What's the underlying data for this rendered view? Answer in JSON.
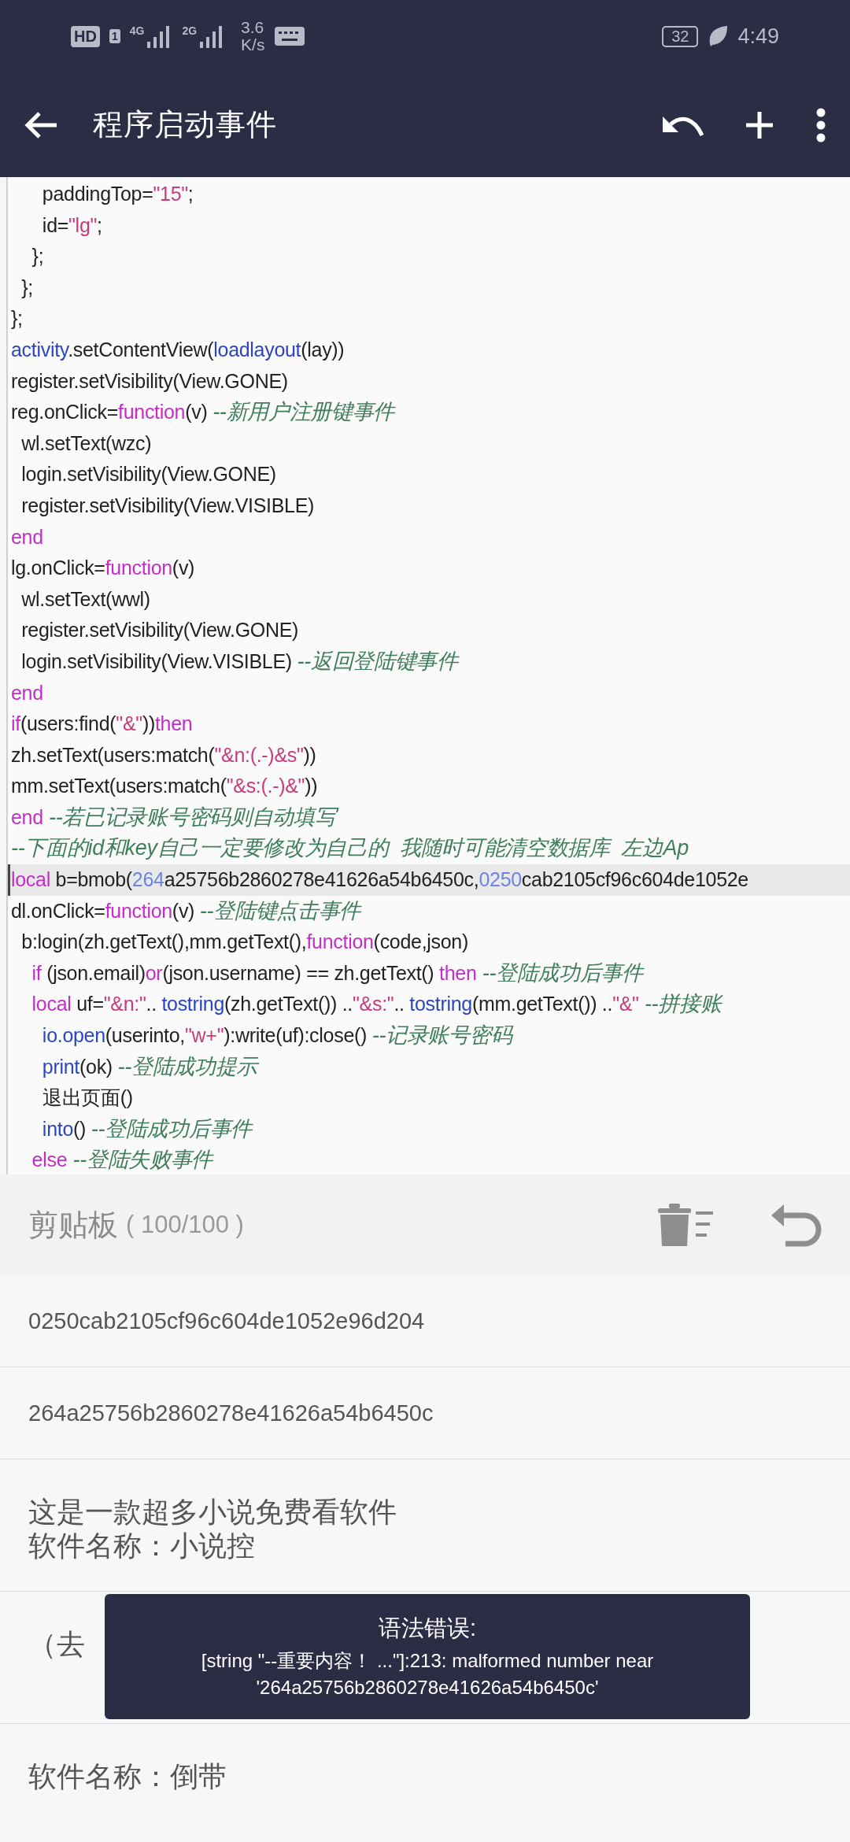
{
  "status_bar": {
    "hd": "HD",
    "sim": "1",
    "signals": [
      "4G",
      "2G"
    ],
    "speed_value": "3.6",
    "speed_unit": "K/s",
    "battery": "32",
    "time": "4:49"
  },
  "toolbar": {
    "title": "程序启动事件"
  },
  "editor": {
    "lines": [
      {
        "current": false,
        "tokens": [
          {
            "kind": "plain",
            "text": "      paddingTop="
          },
          {
            "kind": "str",
            "text": "\"15\""
          },
          {
            "kind": "plain",
            "text": ";"
          }
        ]
      },
      {
        "current": false,
        "tokens": [
          {
            "kind": "plain",
            "text": "      id="
          },
          {
            "kind": "str",
            "text": "\"lg\""
          },
          {
            "kind": "plain",
            "text": ";"
          }
        ]
      },
      {
        "current": false,
        "tokens": [
          {
            "kind": "plain",
            "text": "    };"
          }
        ]
      },
      {
        "current": false,
        "tokens": [
          {
            "kind": "plain",
            "text": "  };"
          }
        ]
      },
      {
        "current": false,
        "tokens": [
          {
            "kind": "plain",
            "text": "};"
          }
        ]
      },
      {
        "current": false,
        "tokens": [
          {
            "kind": "fn",
            "text": "activity"
          },
          {
            "kind": "plain",
            "text": ".setContentView("
          },
          {
            "kind": "fn",
            "text": "loadlayout"
          },
          {
            "kind": "plain",
            "text": "(lay))"
          }
        ]
      },
      {
        "current": false,
        "tokens": [
          {
            "kind": "plain",
            "text": "register.setVisibility(View.GONE)"
          }
        ]
      },
      {
        "current": false,
        "tokens": [
          {
            "kind": "plain",
            "text": "reg.onClick="
          },
          {
            "kind": "kw",
            "text": "function"
          },
          {
            "kind": "plain",
            "text": "(v) "
          },
          {
            "kind": "cmt",
            "text": "--新用户注册键事件"
          }
        ]
      },
      {
        "current": false,
        "tokens": [
          {
            "kind": "plain",
            "text": "  wl.setText(wzc)"
          }
        ]
      },
      {
        "current": false,
        "tokens": [
          {
            "kind": "plain",
            "text": "  login.setVisibility(View.GONE)"
          }
        ]
      },
      {
        "current": false,
        "tokens": [
          {
            "kind": "plain",
            "text": "  register.setVisibility(View.VISIBLE)"
          }
        ]
      },
      {
        "current": false,
        "tokens": [
          {
            "kind": "kw",
            "text": "end"
          }
        ]
      },
      {
        "current": false,
        "tokens": [
          {
            "kind": "plain",
            "text": "lg.onClick="
          },
          {
            "kind": "kw",
            "text": "function"
          },
          {
            "kind": "plain",
            "text": "(v)"
          }
        ]
      },
      {
        "current": false,
        "tokens": [
          {
            "kind": "plain",
            "text": "  wl.setText(wwl)"
          }
        ]
      },
      {
        "current": false,
        "tokens": [
          {
            "kind": "plain",
            "text": "  register.setVisibility(View.GONE)"
          }
        ]
      },
      {
        "current": false,
        "tokens": [
          {
            "kind": "plain",
            "text": "  login.setVisibility(View.VISIBLE) "
          },
          {
            "kind": "cmt",
            "text": "--返回登陆键事件"
          }
        ]
      },
      {
        "current": false,
        "tokens": [
          {
            "kind": "kw",
            "text": "end"
          }
        ]
      },
      {
        "current": false,
        "tokens": [
          {
            "kind": "kw",
            "text": "if"
          },
          {
            "kind": "plain",
            "text": "(users:find("
          },
          {
            "kind": "str",
            "text": "\"&\""
          },
          {
            "kind": "plain",
            "text": "))"
          },
          {
            "kind": "kw",
            "text": "then"
          }
        ]
      },
      {
        "current": false,
        "tokens": [
          {
            "kind": "plain",
            "text": "zh.setText(users:match("
          },
          {
            "kind": "str",
            "text": "\"&n:(.-)&s\""
          },
          {
            "kind": "plain",
            "text": "))"
          }
        ]
      },
      {
        "current": false,
        "tokens": [
          {
            "kind": "plain",
            "text": "mm.setText(users:match("
          },
          {
            "kind": "str",
            "text": "\"&s:(.-)&\""
          },
          {
            "kind": "plain",
            "text": "))"
          }
        ]
      },
      {
        "current": false,
        "tokens": [
          {
            "kind": "kw",
            "text": "end"
          },
          {
            "kind": "cmt",
            "text": " --若已记录账号密码则自动填写"
          }
        ]
      },
      {
        "current": false,
        "tokens": [
          {
            "kind": "cmt",
            "text": "--下面的id和key自己一定要修改为自己的  我随时可能清空数据库  左边Ap"
          }
        ]
      },
      {
        "current": true,
        "tokens": [
          {
            "kind": "kw",
            "text": "local"
          },
          {
            "kind": "plain",
            "text": " b=bmob("
          },
          {
            "kind": "num",
            "text": "264"
          },
          {
            "kind": "plain",
            "text": "a25756b2860278e41626a54b6450c,"
          },
          {
            "kind": "num",
            "text": "0250"
          },
          {
            "kind": "plain",
            "text": "cab2105cf96c604de1052e"
          }
        ]
      },
      {
        "current": false,
        "tokens": [
          {
            "kind": "plain",
            "text": "dl.onClick="
          },
          {
            "kind": "kw",
            "text": "function"
          },
          {
            "kind": "plain",
            "text": "(v) "
          },
          {
            "kind": "cmt",
            "text": "--登陆键点击事件"
          }
        ]
      },
      {
        "current": false,
        "tokens": [
          {
            "kind": "plain",
            "text": "  b:login(zh.getText(),mm.getText(),"
          },
          {
            "kind": "kw",
            "text": "function"
          },
          {
            "kind": "plain",
            "text": "(code,json)"
          }
        ]
      },
      {
        "current": false,
        "tokens": [
          {
            "kind": "kw",
            "text": "    if"
          },
          {
            "kind": "plain",
            "text": " (json.email)"
          },
          {
            "kind": "kw",
            "text": "or"
          },
          {
            "kind": "plain",
            "text": "(json.username) == zh.getText() "
          },
          {
            "kind": "kw",
            "text": "then"
          },
          {
            "kind": "cmt",
            "text": " --登陆成功后事件"
          }
        ]
      },
      {
        "current": false,
        "tokens": [
          {
            "kind": "kw",
            "text": "    local"
          },
          {
            "kind": "plain",
            "text": " uf="
          },
          {
            "kind": "str",
            "text": "\"&n:\""
          },
          {
            "kind": "plain",
            "text": ".. "
          },
          {
            "kind": "fn",
            "text": "tostring"
          },
          {
            "kind": "plain",
            "text": "(zh.getText()) .."
          },
          {
            "kind": "str",
            "text": "\"&s:\""
          },
          {
            "kind": "plain",
            "text": ".. "
          },
          {
            "kind": "fn",
            "text": "tostring"
          },
          {
            "kind": "plain",
            "text": "(mm.getText()) .."
          },
          {
            "kind": "str",
            "text": "\"&\""
          },
          {
            "kind": "cmt",
            "text": " --拼接账"
          }
        ]
      },
      {
        "current": false,
        "tokens": [
          {
            "kind": "fn",
            "text": "      io.open"
          },
          {
            "kind": "plain",
            "text": "(userinto,"
          },
          {
            "kind": "str",
            "text": "\"w+\""
          },
          {
            "kind": "plain",
            "text": "):write(uf):close() "
          },
          {
            "kind": "cmt",
            "text": "--记录账号密码"
          }
        ]
      },
      {
        "current": false,
        "tokens": [
          {
            "kind": "fn",
            "text": "      print"
          },
          {
            "kind": "plain",
            "text": "(ok) "
          },
          {
            "kind": "cmt",
            "text": "--登陆成功提示"
          }
        ]
      },
      {
        "current": false,
        "tokens": [
          {
            "kind": "plain",
            "text": "      退出页面()"
          }
        ]
      },
      {
        "current": false,
        "tokens": [
          {
            "kind": "fn",
            "text": "      into"
          },
          {
            "kind": "plain",
            "text": "() "
          },
          {
            "kind": "cmt",
            "text": "--登陆成功后事件"
          }
        ]
      },
      {
        "current": false,
        "tokens": [
          {
            "kind": "kw",
            "text": "    else"
          },
          {
            "kind": "cmt",
            "text": " --登陆失败事件"
          }
        ]
      }
    ]
  },
  "clipboard": {
    "title": "剪贴板",
    "count": "( 100/100 )",
    "items": [
      {
        "lines": [
          "0250cab2105cf96c604de1052e96d204"
        ]
      },
      {
        "lines": [
          "264a25756b2860278e41626a54b6450c"
        ]
      },
      {
        "lines": [
          "这是一款超多小说免费看软件",
          "软件名称：小说控"
        ]
      },
      {
        "lines": [
          "（去"
        ]
      },
      {
        "lines": [
          "软件名称：倒带"
        ]
      }
    ]
  },
  "toast": {
    "title": "语法错误:",
    "lines": [
      "[string \"--重要内容！ ...\"]:213: malformed number near",
      "'264a25756b2860278e41626a54b6450c'"
    ]
  }
}
